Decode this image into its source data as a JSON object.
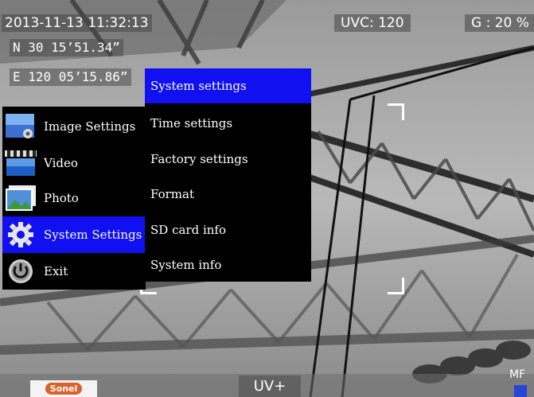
{
  "hud": {
    "datetime": "2013-11-13 11:32:13",
    "latitude": "N 30 15’51.34”",
    "longitude": "E 120 05’15.86”",
    "uvc": "UVC: 120",
    "gain": "G : 20 %",
    "mode": "UV+",
    "focus": "MF"
  },
  "logo": {
    "text": "Sonel"
  },
  "main_menu": {
    "items": [
      {
        "label": "Image Settings",
        "icon": "image-settings-icon",
        "selected": false
      },
      {
        "label": "Video",
        "icon": "video-clapper-icon",
        "selected": false
      },
      {
        "label": "Photo",
        "icon": "photo-icon",
        "selected": false
      },
      {
        "label": "System Settings",
        "icon": "gear-icon",
        "selected": true
      },
      {
        "label": "Exit",
        "icon": "power-icon",
        "selected": false
      }
    ]
  },
  "sub_menu": {
    "items": [
      {
        "label": "System settings",
        "selected": true
      },
      {
        "label": "Time settings",
        "selected": false
      },
      {
        "label": "Factory settings",
        "selected": false
      },
      {
        "label": "Format",
        "selected": false
      },
      {
        "label": "SD card info",
        "selected": false
      },
      {
        "label": "System info",
        "selected": false
      }
    ]
  },
  "colors": {
    "selection": "#1010f0",
    "menu_background": "#000000",
    "focus_indicator": "#2a44d8"
  }
}
